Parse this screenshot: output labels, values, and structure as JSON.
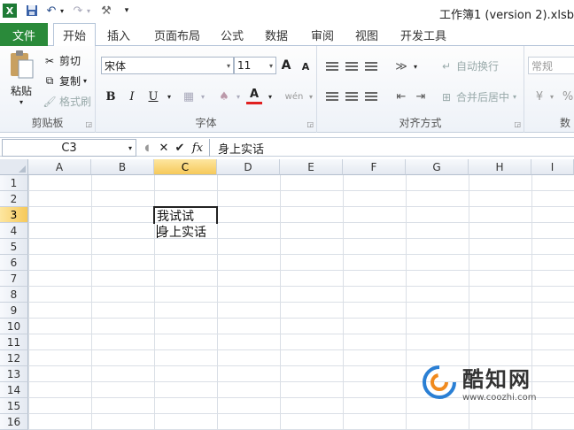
{
  "title_bar": {
    "document_title": "工作簿1 (version 2).xlsb",
    "quick_access": [
      {
        "name": "excel-logo-icon",
        "glyph": "X"
      },
      {
        "name": "save-icon",
        "glyph": "💾"
      },
      {
        "name": "undo-icon",
        "glyph": "↶"
      },
      {
        "name": "redo-icon",
        "glyph": "↷"
      },
      {
        "name": "customize-icon",
        "glyph": "⚒"
      }
    ]
  },
  "tabs": {
    "file": "文件",
    "items": [
      "开始",
      "插入",
      "页面布局",
      "公式",
      "数据",
      "审阅",
      "视图",
      "开发工具"
    ],
    "active_index": 0
  },
  "ribbon": {
    "clipboard": {
      "label": "剪贴板",
      "paste": "粘贴",
      "cut": "剪切",
      "copy": "复制",
      "format_painter": "格式刷"
    },
    "font": {
      "label": "字体",
      "font_name": "宋体",
      "font_size": "11",
      "bold": "B",
      "italic": "I",
      "underline": "U",
      "grow": "A",
      "shrink": "A",
      "font_color": "A",
      "phonetic": "wén"
    },
    "alignment": {
      "label": "对齐方式",
      "wrap_text": "自动换行",
      "merge_center": "合并后居中"
    },
    "number": {
      "format": "常规",
      "percent": "%",
      "label": "数"
    }
  },
  "formula_bar": {
    "cell_reference": "C3",
    "fx": "fx",
    "content": "身上实话"
  },
  "sheet": {
    "columns": [
      "A",
      "B",
      "C",
      "D",
      "E",
      "F",
      "G",
      "H",
      "I"
    ],
    "rows": [
      "1",
      "2",
      "3",
      "4",
      "5",
      "6",
      "7",
      "8",
      "9",
      "10",
      "11",
      "12",
      "13",
      "14",
      "15",
      "16"
    ],
    "selected_column": "C",
    "selected_row": "3",
    "cell_c3_line1": "我试试",
    "cell_c3_line2": "身上实话"
  },
  "watermark": {
    "name": "酷知网",
    "url": "www.coozhi.com"
  },
  "colors": {
    "file_tab": "#2a8a3a",
    "header_selected": "#f6c95a",
    "font_color_underline": "#e02020"
  }
}
